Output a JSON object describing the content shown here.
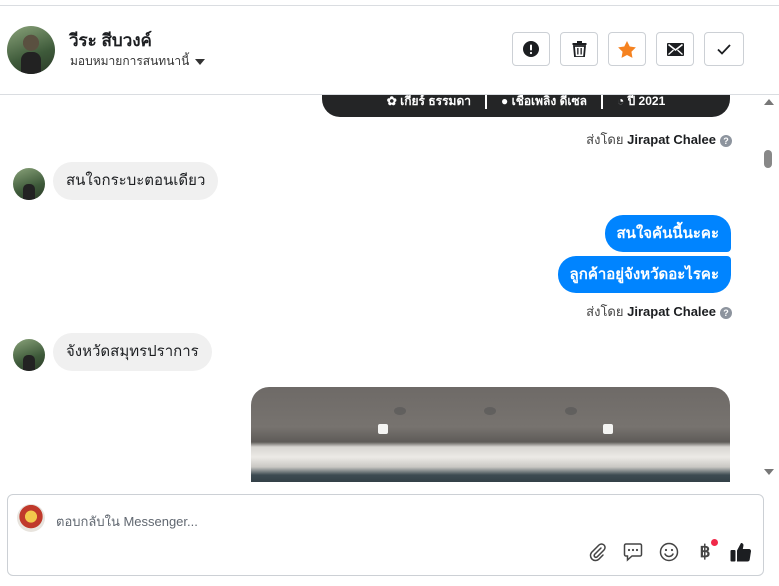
{
  "header": {
    "name": "วีระ สีบวงค์",
    "subtitle": "มอบหมายการสนทนานี้",
    "actions": [
      {
        "name": "report-button",
        "icon": "exclamation-icon"
      },
      {
        "name": "delete-button",
        "icon": "trash-icon"
      },
      {
        "name": "star-button",
        "icon": "star-icon",
        "color": "#f58220"
      },
      {
        "name": "email-button",
        "icon": "envelope-icon"
      },
      {
        "name": "done-button",
        "icon": "check-icon"
      }
    ]
  },
  "card": {
    "gear": "เกียร์ ธรรมดา",
    "fuel": "เชื้อเพลิง ดีเซล",
    "year": "ปี 2021"
  },
  "sent_by": {
    "prefix": "ส่งโดย",
    "name": "Jirapat Chalee"
  },
  "messages": {
    "in_1": "สนใจกระบะตอนเดียว",
    "out_1": "สนใจคันนี้นะคะ",
    "out_2": "ลูกค้าอยู่จังหวัดอะไรคะ",
    "in_2": "จังหวัดสมุทรปราการ"
  },
  "composer": {
    "placeholder": "ตอบกลับใน Messenger...",
    "icons": [
      "paperclip-icon",
      "chat-bubble-icon",
      "smiley-icon",
      "baht-icon",
      "thumbs-up-icon"
    ],
    "baht_symbol": "฿"
  },
  "colors": {
    "accent": "#0084ff",
    "star": "#f58220",
    "notification": "#f02849"
  }
}
